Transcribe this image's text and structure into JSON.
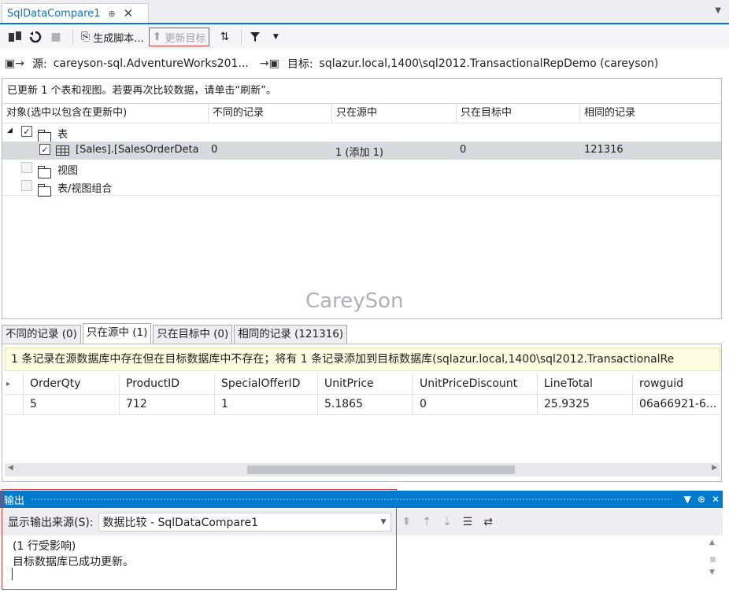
{
  "doc_tab": {
    "title": "SqlDataCompare1",
    "pin": "⊕",
    "close": "✕"
  },
  "toolbar": {
    "generate_script_label": "生成脚本...",
    "update_target_label": "更新目标"
  },
  "connection": {
    "source_label": "源:",
    "source_value": "careyson-sql.AdventureWorks201...",
    "target_label": "目标:",
    "target_value": "sqlazur.local,1400\\sql2012.TransactionalRepDemo (careyson)"
  },
  "status_message": "已更新 1 个表和视图。若要再次比较数据，请单击“刷新”。",
  "compare_grid": {
    "columns": [
      "对象(选中以包含在更新中)",
      "不同的记录",
      "只在源中",
      "只在目标中",
      "相同的记录"
    ],
    "tree": {
      "group_tables": "表",
      "row": {
        "name": "[Sales].[SalesOrderDeta",
        "different": "0",
        "only_source": "1 (添加 1)",
        "only_target": "0",
        "identical": "121316"
      },
      "group_views": "视图",
      "group_combos": "表/视图组合"
    }
  },
  "watermark": "CareySon",
  "detail_tabs": [
    "不同的记录 (0)",
    "只在源中 (1)",
    "只在目标中 (0)",
    "相同的记录 (121316)"
  ],
  "detail_info": "1 条记录在源数据库中存在但在目标数据库中不存在；将有 1 条记录添加到目标数据库(sqlazur.local,1400\\sql2012.TransactionalRe",
  "detail_grid": {
    "columns": [
      "OrderQty",
      "ProductID",
      "SpecialOfferID",
      "UnitPrice",
      "UnitPriceDiscount",
      "LineTotal",
      "rowguid"
    ],
    "row": [
      "5",
      "712",
      "1",
      "5.1865",
      "0",
      "25.9325",
      "06a66921-6..."
    ]
  },
  "output": {
    "title": "输出",
    "source_label": "显示输出来源(S):",
    "source_value": "数据比较 - SqlDataCompare1",
    "lines": [
      "(1 行受影响)",
      "目标数据库已成功更新。"
    ]
  }
}
